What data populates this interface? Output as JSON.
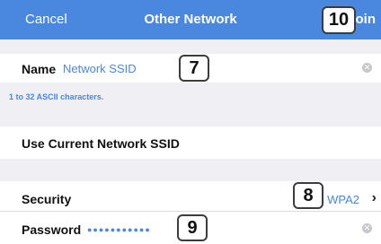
{
  "navbar": {
    "cancel_label": "Cancel",
    "title": "Other Network",
    "join_label": "Join"
  },
  "name_row": {
    "label": "Name",
    "placeholder": "Network SSID",
    "clear_icon": "clear-x-icon"
  },
  "hint": "1 to 32 ASCII characters.",
  "current_ssid_label": "Use Current Network SSID",
  "security_row": {
    "label": "Security",
    "value": "WPA2",
    "chevron_icon": "chevron-right-icon"
  },
  "password_row": {
    "label": "Password",
    "masked_value": "●●●●●●●●●●●",
    "clear_icon": "clear-x-icon"
  },
  "callouts": {
    "join": "10",
    "name": "7",
    "security": "8",
    "password": "9"
  },
  "colors": {
    "accent": "#4a87de",
    "background": "#efeff4"
  }
}
